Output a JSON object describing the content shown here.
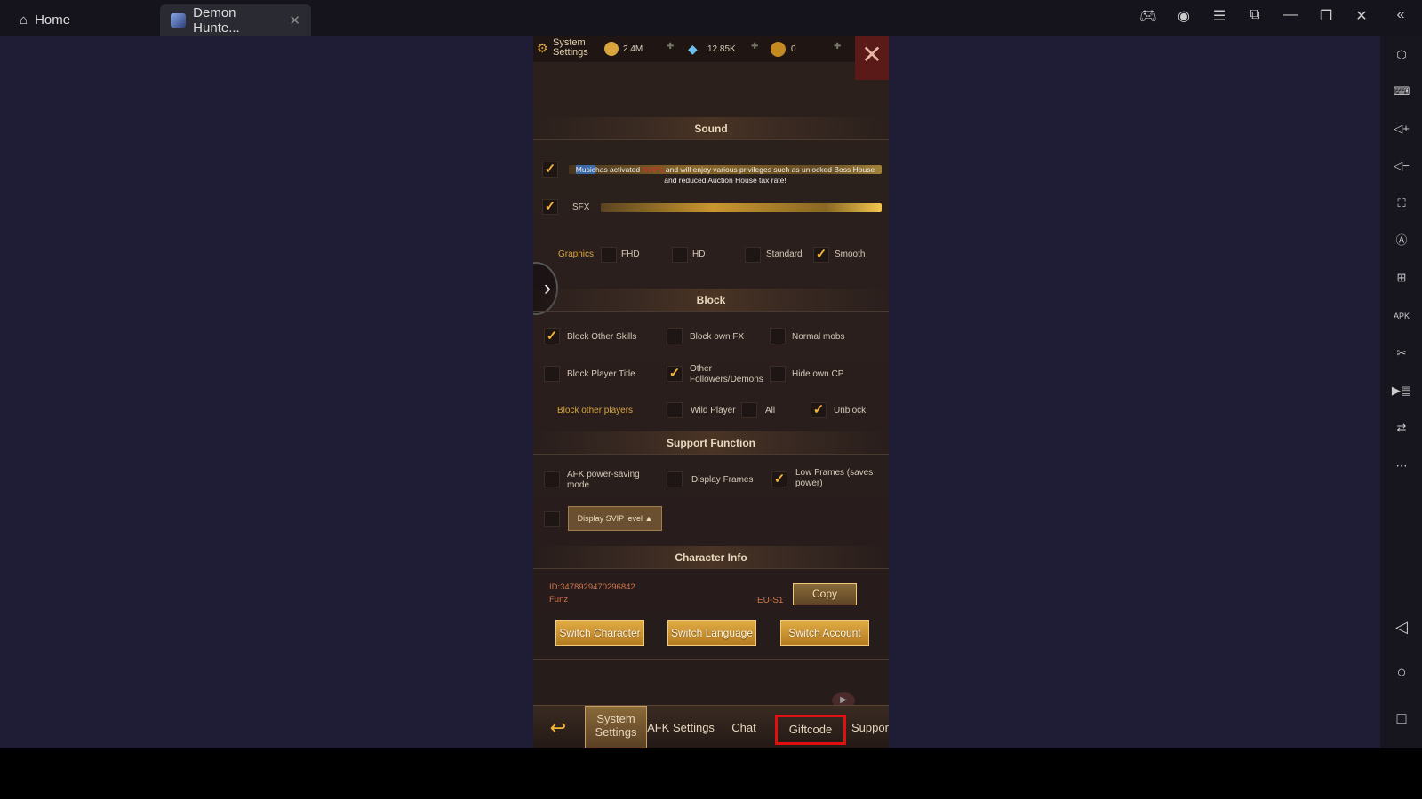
{
  "window": {
    "tabs": [
      {
        "label": "Home",
        "icon": "home-icon"
      },
      {
        "label": "Demon Hunte...",
        "icon": "game-icon"
      }
    ],
    "controls": [
      "gamepad-icon",
      "account-icon",
      "menu-icon",
      "resize-icon",
      "minimize-icon",
      "restore-icon",
      "close-icon",
      "collapse-icon"
    ]
  },
  "sidebar": {
    "icons": [
      "settings-icon",
      "keyboard-icon",
      "volume-up-icon",
      "volume-down-icon",
      "screenshot-icon",
      "auto-rotate-icon",
      "multi-instance-icon",
      "apk-install-icon",
      "scissors-icon",
      "record-icon",
      "sync-icon",
      "more-icon",
      "back-icon",
      "home-circle-icon",
      "recents-icon"
    ]
  },
  "game": {
    "header": {
      "title_line1": "System",
      "title_line2": "Settings",
      "gold": "2.4M",
      "diamonds": "12.85K",
      "tokens": "0"
    },
    "sound": {
      "title": "Sound",
      "music_highlight": "Music",
      "music_text_a": "has activated ",
      "music_svip": "SVIP1",
      "music_text_b": " and will enjoy various privileges such as unlocked Boss House and reduced Auction House tax rate!",
      "music_checked": true,
      "sfx_label": "SFX",
      "sfx_checked": true,
      "music_volume": 1.0,
      "sfx_volume": 1.0
    },
    "graphics": {
      "label": "Graphics",
      "options": [
        {
          "label": "FHD",
          "checked": false
        },
        {
          "label": "HD",
          "checked": false
        },
        {
          "label": "Standard",
          "checked": false
        },
        {
          "label": "Smooth",
          "checked": true
        }
      ]
    },
    "block": {
      "title": "Block",
      "items": [
        {
          "label": "Block Other Skills",
          "checked": true
        },
        {
          "label": "Block own FX",
          "checked": false
        },
        {
          "label": "Normal mobs",
          "checked": false
        },
        {
          "label": "Block Player Title",
          "checked": false
        },
        {
          "label": "Other Followers/Demons",
          "checked": true
        },
        {
          "label": "Hide own CP",
          "checked": false
        }
      ],
      "players_label": "Block other players",
      "players_options": [
        {
          "label": "Wild Player",
          "checked": false
        },
        {
          "label": "All",
          "checked": false
        },
        {
          "label": "Unblock",
          "checked": true
        }
      ]
    },
    "support": {
      "title": "Support Function",
      "items": [
        {
          "label": "AFK power-saving mode",
          "checked": false
        },
        {
          "label": "Display Frames",
          "checked": false
        },
        {
          "label": "Low Frames (saves power)",
          "checked": true
        }
      ],
      "svip_checked": false,
      "svip_dropdown": "Display SVIP level"
    },
    "character": {
      "title": "Character Info",
      "id": "ID:3478929470296842",
      "name": "Funz",
      "server": "EU-S1",
      "copy": "Copy",
      "switch_character": "Switch Character",
      "switch_language": "Switch Language",
      "switch_account": "Switch Account"
    },
    "tabs": [
      "System Settings",
      "AFK Settings",
      "Chat",
      "Giftcode",
      "Suppor"
    ],
    "active_tab": "System Settings",
    "highlighted_tab": "Giftcode",
    "highlight_color": "#e01010"
  }
}
